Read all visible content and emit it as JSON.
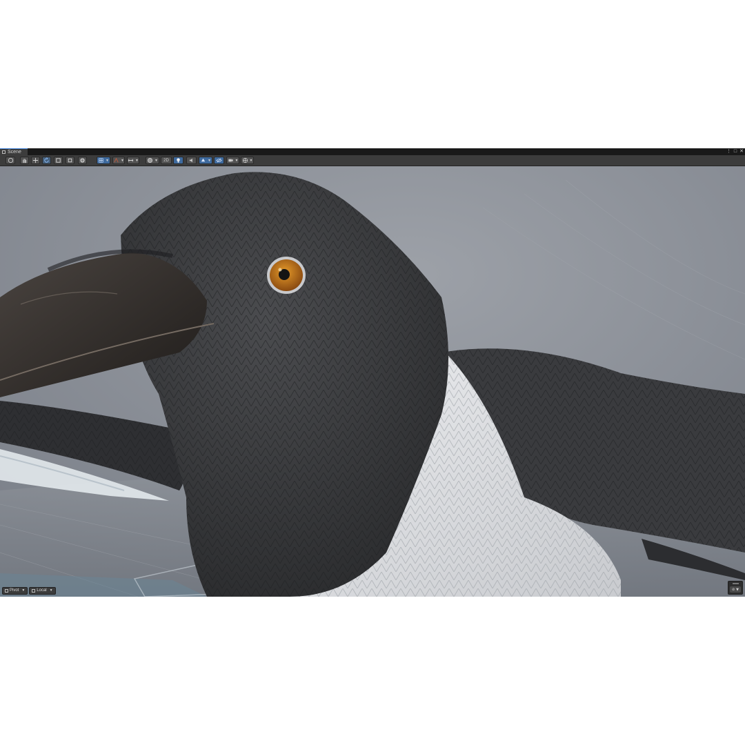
{
  "window": {
    "tab_label": "Scene",
    "tab_icon": "hamburger-icon",
    "controls": [
      "⋮",
      "□",
      "✕"
    ]
  },
  "toolbar": {
    "toggle_2d_label": "2D",
    "tools": [
      {
        "name": "view-tool-icon"
      },
      {
        "name": "hand-tool-icon"
      },
      {
        "name": "move-tool-icon"
      },
      {
        "name": "rotate-tool-icon",
        "active": true
      },
      {
        "name": "scale-tool-icon"
      },
      {
        "name": "rect-tool-icon"
      },
      {
        "name": "transform-tool-icon"
      }
    ]
  },
  "bottom_overlay": {
    "pivot_label": "Pivot",
    "local_label": "Local"
  },
  "colors": {
    "accent": "#3d7fd6",
    "panel": "#3c3c3c",
    "background_dark": "#191919"
  }
}
